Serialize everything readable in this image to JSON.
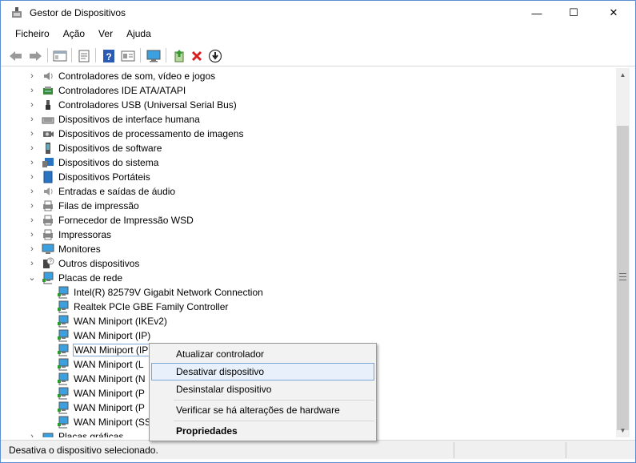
{
  "window": {
    "title": "Gestor de Dispositivos",
    "min_glyph": "—",
    "max_glyph": "☐",
    "close_glyph": "✕"
  },
  "menu": [
    "Ficheiro",
    "Ação",
    "Ver",
    "Ajuda"
  ],
  "toolbar": [
    "back-icon",
    "forward-icon",
    "show-hide-tree-icon",
    "properties-icon",
    "help-icon",
    "view-icon",
    "monitor-icon",
    "update-driver-icon",
    "uninstall-icon",
    "disable-icon"
  ],
  "tree": {
    "categories": [
      {
        "label": "Controladores de som, vídeo e jogos",
        "icon": "speaker-icon"
      },
      {
        "label": "Controladores IDE ATA/ATAPI",
        "icon": "ide-icon"
      },
      {
        "label": "Controladores USB (Universal Serial Bus)",
        "icon": "usb-icon"
      },
      {
        "label": "Dispositivos de interface humana",
        "icon": "hid-icon"
      },
      {
        "label": "Dispositivos de processamento de imagens",
        "icon": "camera-icon"
      },
      {
        "label": "Dispositivos de software",
        "icon": "software-icon"
      },
      {
        "label": "Dispositivos do sistema",
        "icon": "system-icon"
      },
      {
        "label": "Dispositivos Portáteis",
        "icon": "portable-icon"
      },
      {
        "label": "Entradas e saídas de áudio",
        "icon": "audio-icon"
      },
      {
        "label": "Filas de impressão",
        "icon": "print-queue-icon"
      },
      {
        "label": "Fornecedor de Impressão WSD",
        "icon": "printer-icon"
      },
      {
        "label": "Impressoras",
        "icon": "printer-icon"
      },
      {
        "label": "Monitores",
        "icon": "monitor-icon"
      },
      {
        "label": "Outros dispositivos",
        "icon": "unknown-device-icon"
      },
      {
        "label": "Placas de rede",
        "icon": "network-icon"
      }
    ],
    "network_children": [
      "Intel(R) 82579V Gigabit Network Connection",
      "Realtek PCIe GBE Family Controller",
      "WAN Miniport (IKEv2)",
      "WAN Miniport (IP)",
      "WAN Miniport (IP",
      "WAN Miniport (L",
      "WAN Miniport (N",
      "WAN Miniport (P",
      "WAN Miniport (P",
      "WAN Miniport (SS"
    ],
    "next_category": "Placas gráficas",
    "expand_glyph": "›",
    "expanded_glyph": "⌄"
  },
  "context_menu": {
    "update": "Atualizar controlador",
    "disable": "Desativar dispositivo",
    "uninstall": "Desinstalar dispositivo",
    "scan": "Verificar se há alterações de hardware",
    "properties": "Propriedades"
  },
  "status": {
    "text": "Desativa o dispositivo selecionado."
  },
  "colors": {
    "accent": "#1e7fd0",
    "selection": "#7aa7d8",
    "uninstall_red": "#d81e1e"
  }
}
